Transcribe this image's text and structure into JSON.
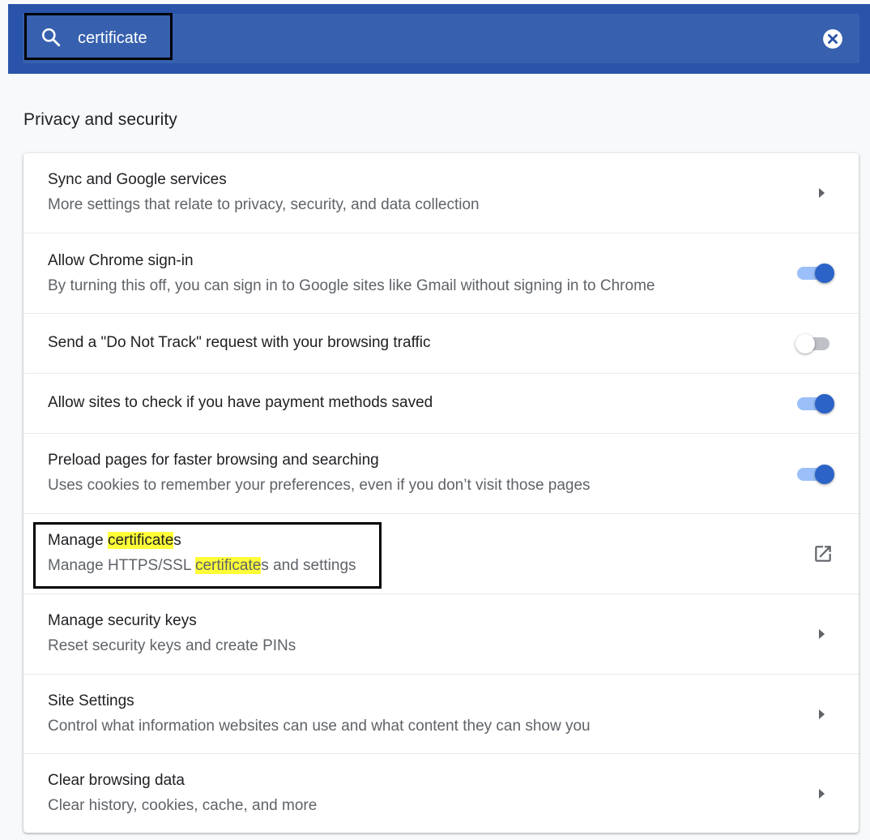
{
  "search": {
    "value": "certificate",
    "icon": "search-icon",
    "clear_icon": "close-circle-icon"
  },
  "section": {
    "title": "Privacy and security"
  },
  "rows": [
    {
      "title": "Sync and Google services",
      "subtitle": "More settings that relate to privacy, security, and data collection",
      "control": "chevron"
    },
    {
      "title": "Allow Chrome sign-in",
      "subtitle": "By turning this off, you can sign in to Google sites like Gmail without signing in to Chrome",
      "control": "toggle",
      "checked": true
    },
    {
      "title": "Send a \"Do Not Track\" request with your browsing traffic",
      "control": "toggle",
      "checked": false
    },
    {
      "title": "Allow sites to check if you have payment methods saved",
      "control": "toggle",
      "checked": true
    },
    {
      "title": "Preload pages for faster browsing and searching",
      "subtitle": "Uses cookies to remember your preferences, even if you don’t visit those pages",
      "control": "toggle",
      "checked": true
    },
    {
      "title_pre": "Manage ",
      "title_hl": "certificate",
      "title_post": "s",
      "subtitle_pre": "Manage HTTPS/SSL ",
      "subtitle_hl": "certificate",
      "subtitle_post": "s and settings",
      "control": "external-link"
    },
    {
      "title": "Manage security keys",
      "subtitle": "Reset security keys and create PINs",
      "control": "chevron"
    },
    {
      "title": "Site Settings",
      "subtitle": "Control what information websites can use and what content they can show you",
      "control": "chevron"
    },
    {
      "title": "Clear browsing data",
      "subtitle": "Clear history, cookies, cache, and more",
      "control": "chevron"
    }
  ],
  "colors": {
    "header": "#2a54a9",
    "search_bar": "#3761ae",
    "toggle_on": "#2b63c7",
    "highlight": "#ffff38"
  }
}
